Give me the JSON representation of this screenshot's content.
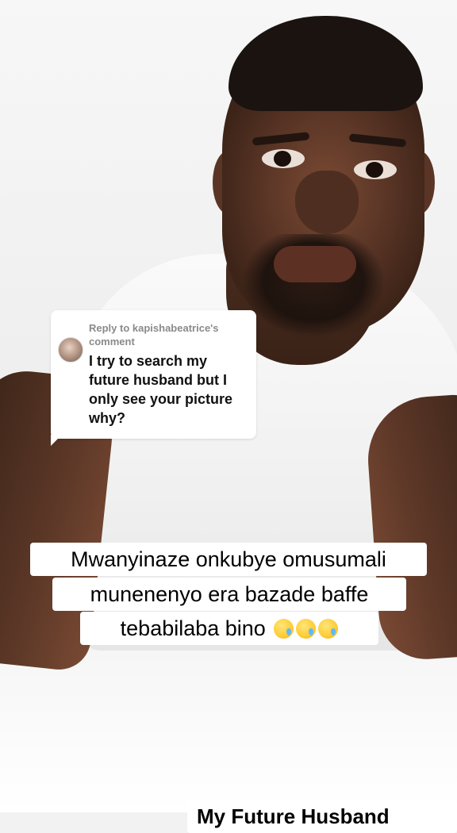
{
  "reply": {
    "header": "Reply to kapishabeatrice's comment",
    "comment": "I try to search my future husband but I only see your picture why?"
  },
  "caption": {
    "line1": "Mwanyinaze onkubye omusumali",
    "line2": "munenenyo era bazade baffe",
    "line3": "tebabilaba bino",
    "emoji_name": "face-holding-back-tears-icon",
    "emoji_count": 3
  },
  "bottom_label": "My Future Husband"
}
